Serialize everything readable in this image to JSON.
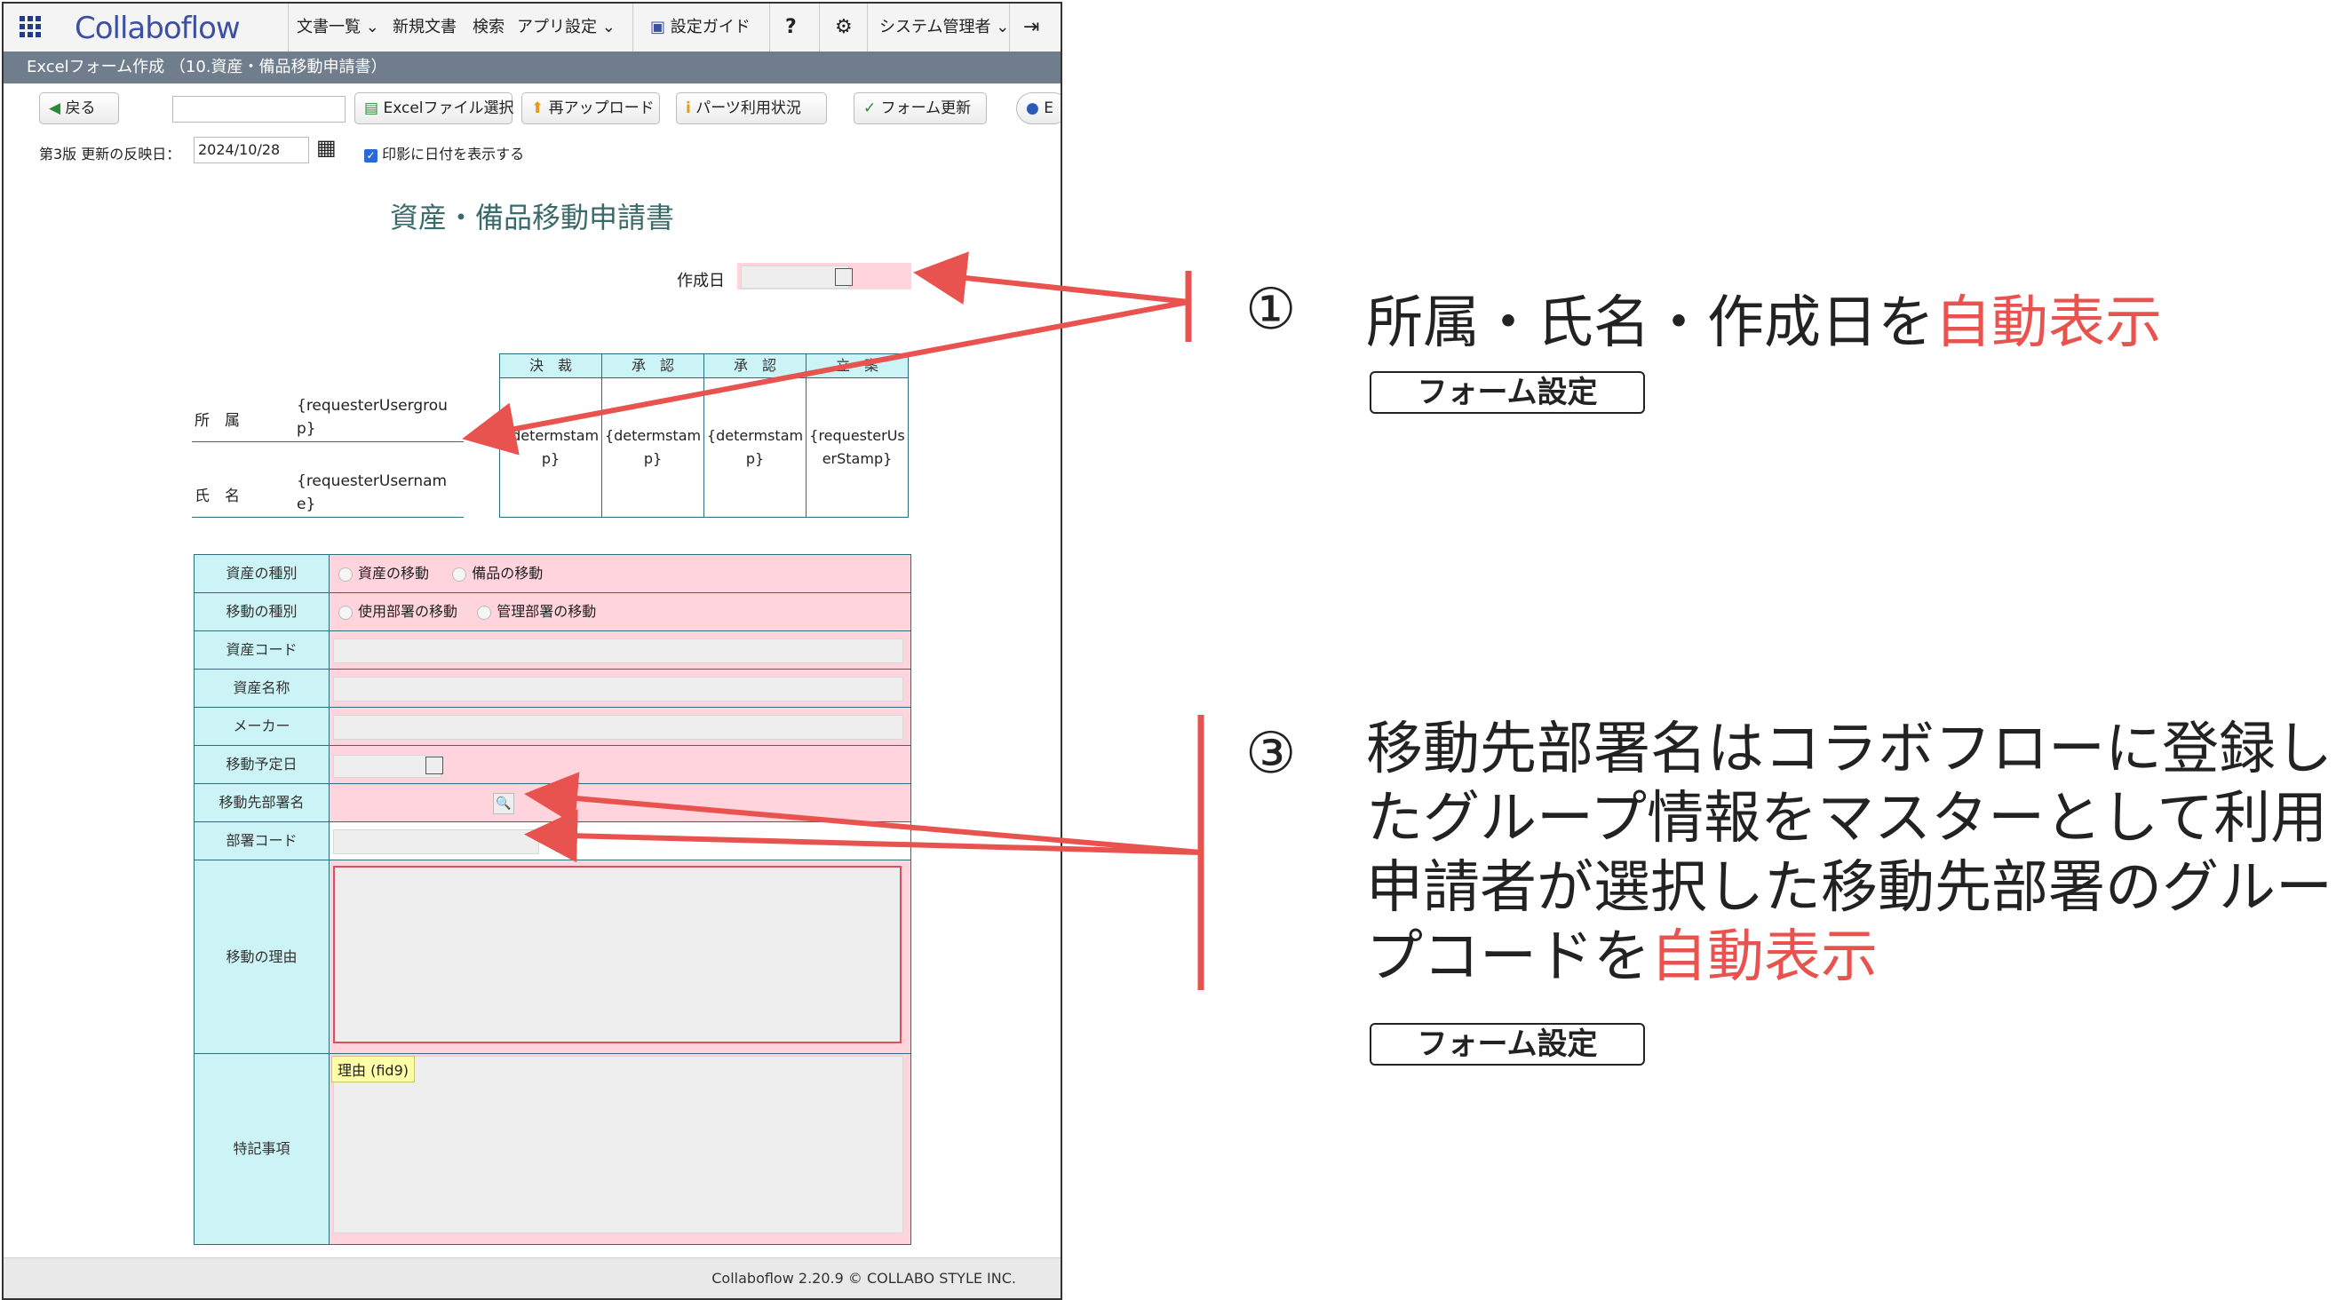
{
  "app": {
    "logo": "Collaboflow",
    "nav": {
      "documents": "文書一覧",
      "new_document": "新規文書",
      "search": "検索",
      "app_settings": "アプリ設定",
      "settings_guide": "設定ガイド",
      "help": "?",
      "admin": "システム管理者"
    },
    "page_title": "Excelフォーム作成 （10.資産・備品移動申請書）",
    "toolbar": {
      "back": "戻る",
      "excel_select": "Excelファイル選択",
      "reupload": "再アップロード",
      "parts_usage": "パーツ利用状況",
      "form_update": "フォーム更新",
      "extra": "E"
    },
    "version_label": "第3版 更新の反映日：",
    "reflect_date": "2024/10/28",
    "stamp_date_label": "印影に日付を表示する",
    "footer": "Collaboflow 2.20.9 © COLLABO STYLE INC."
  },
  "form": {
    "title": "資産・備品移動申請書",
    "created_date_label": "作成日",
    "dept_label": "所　属",
    "dept_value": "{requesterUsergroup}",
    "name_label": "氏　名",
    "name_value": "{requesterUsername}",
    "approval_headers": [
      "決　裁",
      "承　認",
      "承　認",
      "立　案"
    ],
    "approval_values": [
      "{determstamp}",
      "{determstamp}",
      "{determstamp}",
      "{requesterUserStamp}"
    ],
    "rows": {
      "asset_type": "資産の種別",
      "asset_type_opt1": "資産の移動",
      "asset_type_opt2": "備品の移動",
      "move_type": "移動の種別",
      "move_type_opt1": "使用部署の移動",
      "move_type_opt2": "管理部署の移動",
      "asset_code": "資産コード",
      "asset_name": "資産名称",
      "maker": "メーカー",
      "move_date": "移動予定日",
      "dest_dept": "移動先部署名",
      "dept_code": "部署コード",
      "reason": "移動の理由",
      "notes": "特記事項"
    },
    "tooltip": "理由 (fid9)"
  },
  "annotations": {
    "a1_num": "①",
    "a1_text": "所属・氏名・作成日を",
    "a1_red": "自動表示",
    "a1_tag": "フォーム設定",
    "a3_num": "③",
    "a3_line1": "移動先部署名はコラボフローに登録し",
    "a3_line2": "たグループ情報をマスターとして利用",
    "a3_line3": "申請者が選択した移動先部署のグルー",
    "a3_line4a": "プコードを",
    "a3_line4_red": "自動表示",
    "a3_tag": "フォーム設定"
  },
  "colors": {
    "accent_red": "#e8534f",
    "label_cyan": "#ccf3f5",
    "field_pink": "#ffd4dc",
    "title_bar": "#6f7d8c"
  }
}
